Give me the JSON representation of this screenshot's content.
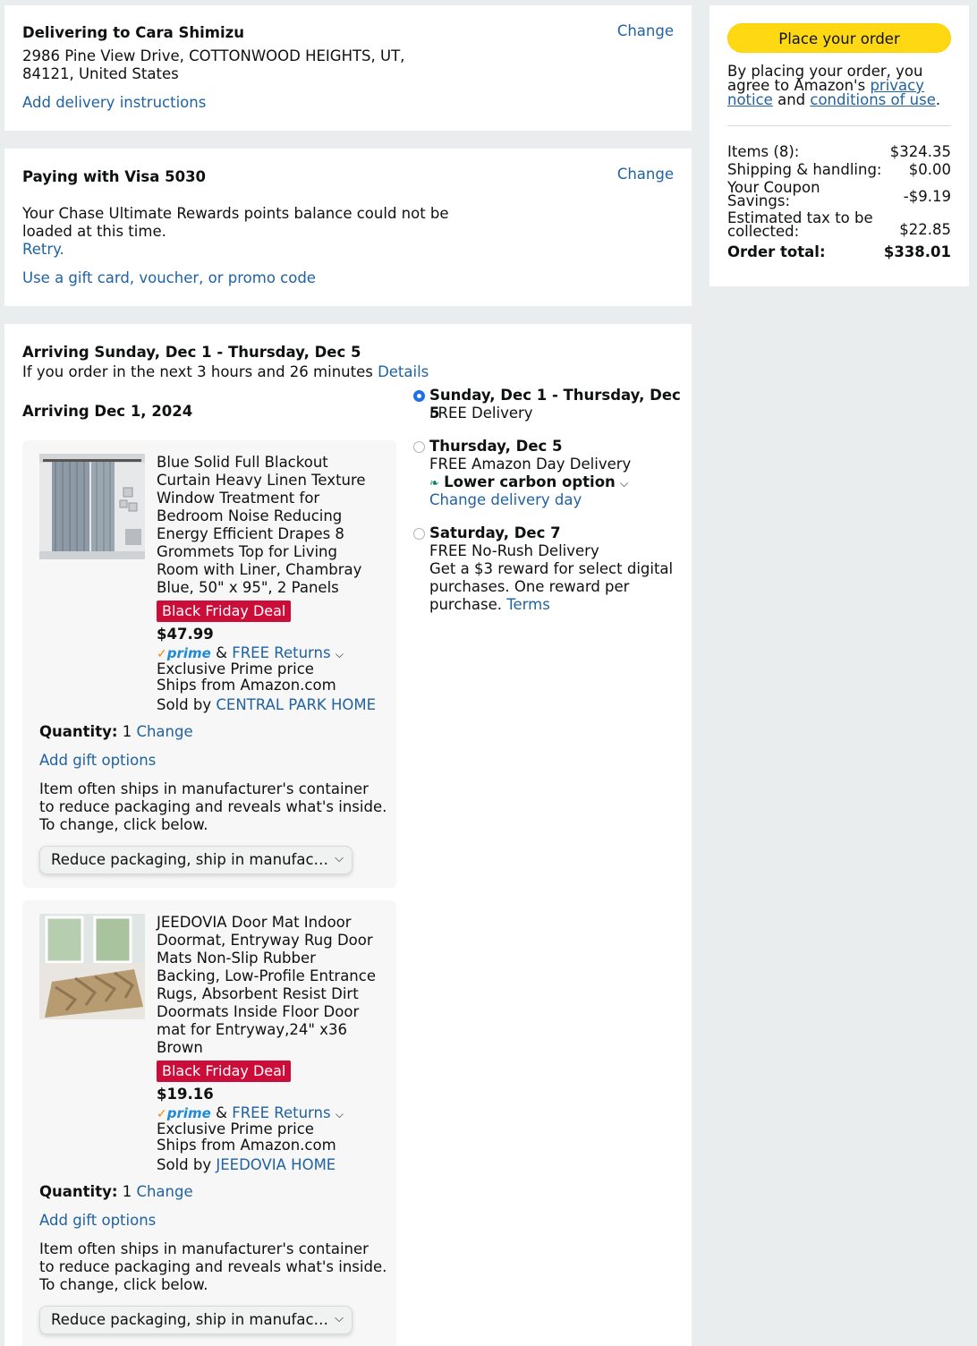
{
  "address": {
    "heading": "Delivering to Cara Shimizu",
    "line1": "2986 Pine View Drive, COTTONWOOD HEIGHTS, UT,",
    "line2": "84121, United States",
    "instructions_link": "Add delivery instructions",
    "change_label": "Change"
  },
  "payment": {
    "heading": "Paying with Visa 5030",
    "rewards_msg_1": "Your Chase Ultimate Rewards points balance could not be",
    "rewards_msg_2": "loaded at this time.",
    "retry_label": "Retry.",
    "gift_card_link": "Use a gift card, voucher, or promo code",
    "change_label": "Change"
  },
  "shipment": {
    "arriving_range": "Arriving Sunday, Dec 1 - Thursday, Dec 5",
    "order_within": "If you order in the next 3 hours and 26 minutes",
    "details_link": "Details",
    "arriving_date": "Arriving Dec 1, 2024",
    "options": [
      {
        "title": "Sunday, Dec 1 - Thursday, Dec 5",
        "line1": "FREE Delivery",
        "selected": true
      },
      {
        "title": "Thursday, Dec 5",
        "line1": "FREE Amazon Day Delivery",
        "carbon_label": "Lower carbon option",
        "change_day_link": "Change delivery day",
        "selected": false
      },
      {
        "title": "Saturday, Dec 7",
        "line1": "FREE No-Rush Delivery",
        "line2": "Get a $3 reward for select digital",
        "line3": "purchases. One reward per",
        "line4": "purchase.",
        "terms_link": "Terms",
        "selected": false
      }
    ],
    "items": [
      {
        "title_lines": [
          "Blue Solid Full Blackout",
          "Curtain Heavy Linen Texture",
          "Window Treatment for",
          "Bedroom Noise Reducing",
          "Energy Efficient Drapes 8",
          "Grommets Top for Living",
          "Room with Liner, Chambray",
          "Blue, 50\" x 95\", 2 Panels"
        ],
        "deal_badge": "Black Friday Deal",
        "price": "$47.99",
        "prime_label": "prime",
        "amp": "&",
        "returns_link": "FREE Returns",
        "exclusive": "Exclusive Prime price",
        "ships_from": "Ships from Amazon.com",
        "sold_by_label": "Sold by",
        "seller": "CENTRAL PARK HOME",
        "quantity_label": "Quantity:",
        "quantity": "1",
        "quantity_change": "Change",
        "gift_options": "Add gift options",
        "packaging_lines": [
          "Item often ships in manufacturer's container",
          "to reduce packaging and reveals what's inside.",
          "To change, click below."
        ],
        "packaging_select": "Reduce packaging, ship in manufac…"
      },
      {
        "title_lines": [
          "JEEDOVIA Door Mat Indoor",
          "Doormat, Entryway Rug Door",
          "Mats Non-Slip Rubber",
          "Backing, Low-Profile Entrance",
          "Rugs, Absorbent Resist Dirt",
          "Doormats Inside Floor Door",
          "mat for Entryway,24\" x36",
          "Brown"
        ],
        "deal_badge": "Black Friday Deal",
        "price": "$19.16",
        "prime_label": "prime",
        "amp": "&",
        "returns_link": "FREE Returns",
        "exclusive": "Exclusive Prime price",
        "ships_from": "Ships from Amazon.com",
        "sold_by_label": "Sold by",
        "seller": "JEEDOVIA HOME",
        "quantity_label": "Quantity:",
        "quantity": "1",
        "quantity_change": "Change",
        "gift_options": "Add gift options",
        "packaging_lines": [
          "Item often ships in manufacturer's container",
          "to reduce packaging and reveals what's inside.",
          "To change, click below."
        ],
        "packaging_select": "Reduce packaging, ship in manufac…"
      }
    ]
  },
  "summary": {
    "place_order": "Place your order",
    "agree_1": "By placing your order, you",
    "agree_2": "agree to Amazon's",
    "privacy_1": "privacy",
    "privacy_2": "notice",
    "and": "and",
    "conditions": "conditions of use",
    "period": ".",
    "items_label": "Items (8):",
    "items_value": "$324.35",
    "shipping_label": "Shipping & handling:",
    "shipping_value": "$0.00",
    "coupon_label_1": "Your Coupon",
    "coupon_label_2": "Savings:",
    "coupon_value": "-$9.19",
    "tax_label_1": "Estimated tax to be",
    "tax_label_2": "collected:",
    "tax_value": "$22.85",
    "total_label": "Order total:",
    "total_value": "$338.01"
  },
  "colors": {
    "link": "#2162a1",
    "deal_badge": "#cc0c39",
    "place_button": "#ffd814",
    "prime": "#1f8ad7"
  }
}
